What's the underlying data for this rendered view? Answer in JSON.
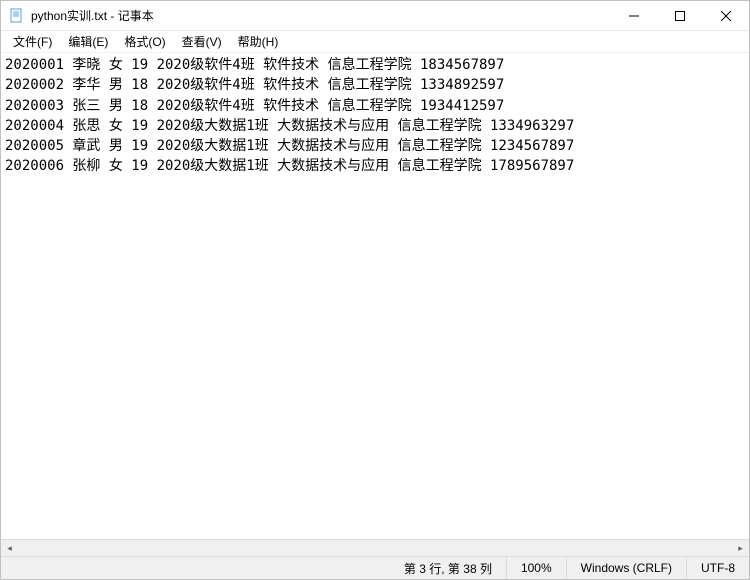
{
  "window": {
    "title": "python实训.txt - 记事本",
    "icon_name": "notepad-icon"
  },
  "menu": {
    "file": "文件(F)",
    "edit": "编辑(E)",
    "format": "格式(O)",
    "view": "查看(V)",
    "help": "帮助(H)"
  },
  "content_lines": [
    "2020001 李晓 女 19 2020级软件4班 软件技术 信息工程学院 1834567897",
    "2020002 李华 男 18 2020级软件4班 软件技术 信息工程学院 1334892597",
    "2020003 张三 男 18 2020级软件4班 软件技术 信息工程学院 1934412597",
    "2020004 张思 女 19 2020级大数据1班 大数据技术与应用 信息工程学院 1334963297",
    "2020005 章武 男 19 2020级大数据1班 大数据技术与应用 信息工程学院 1234567897",
    "2020006 张柳 女 19 2020级大数据1班 大数据技术与应用 信息工程学院 1789567897"
  ],
  "statusbar": {
    "position": "第 3 行, 第 38 列",
    "zoom": "100%",
    "line_ending": "Windows (CRLF)",
    "encoding": "UTF-8"
  }
}
